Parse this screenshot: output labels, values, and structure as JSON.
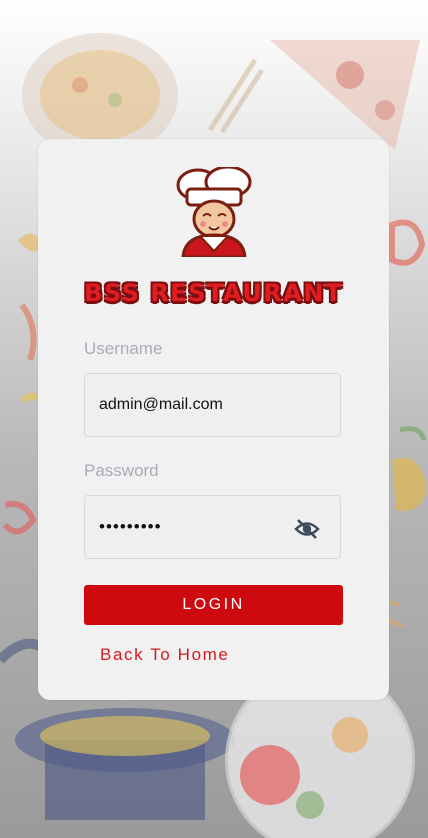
{
  "brand": {
    "name": "BSS RESTAURANT"
  },
  "icons": {
    "logo": "chef-mascot-icon",
    "password_toggle": "eye-slash-icon"
  },
  "colors": {
    "primary": "#cf0a0f",
    "card_bg": "#f1f1f1",
    "label": "#a8abb8"
  },
  "form": {
    "username": {
      "label": "Username",
      "value": "admin@mail.com"
    },
    "password": {
      "label": "Password",
      "value": "•••••••••"
    },
    "login_label": "LOGIN",
    "back_label": "Back To Home"
  }
}
